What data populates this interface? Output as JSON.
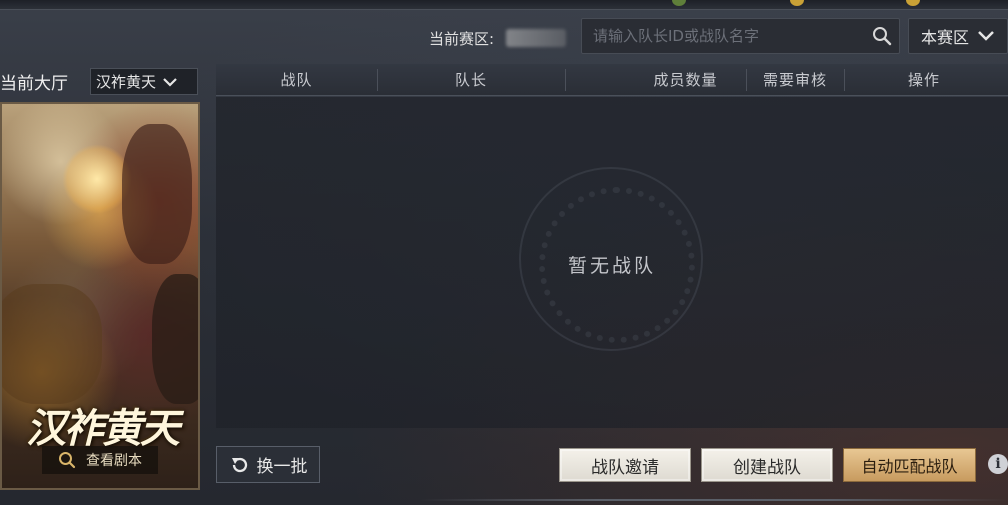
{
  "header": {
    "zone_label": "当前赛区:",
    "search_placeholder": "请输入队长ID或战队名字",
    "zone_select_value": "本赛区"
  },
  "left_panel": {
    "hall_title": "当前大厅",
    "hall_select_value": "汉祚黄天",
    "scenario_title": "汉祚黄天",
    "view_script_label": "查看剧本"
  },
  "table": {
    "columns": [
      "战队",
      "队长",
      "成员数量",
      "需要审核",
      "操作"
    ],
    "empty_text": "暂无战队"
  },
  "actions": {
    "refresh_label": "换一批",
    "invite_label": "战队邀请",
    "create_label": "创建战队",
    "auto_match_label": "自动匹配战队",
    "info_label": "i"
  },
  "colors": {
    "accent_gold": "#c89b5f",
    "background": "#2b2f37"
  }
}
